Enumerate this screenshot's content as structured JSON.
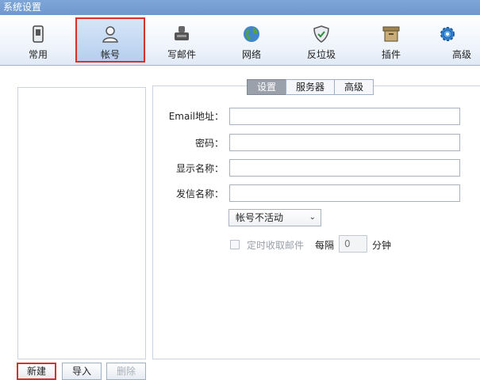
{
  "window": {
    "title": "系统设置"
  },
  "toolbar": {
    "items": [
      {
        "label": "常用",
        "icon": "phone-icon"
      },
      {
        "label": "帐号",
        "icon": "user-icon"
      },
      {
        "label": "写邮件",
        "icon": "compose-icon"
      },
      {
        "label": "网络",
        "icon": "globe-icon"
      },
      {
        "label": "反垃圾",
        "icon": "shield-icon"
      },
      {
        "label": "插件",
        "icon": "box-icon"
      },
      {
        "label": "高级",
        "icon": "gear-icon"
      }
    ],
    "active": "帐号"
  },
  "tabs": [
    {
      "label": "设置"
    },
    {
      "label": "服务器"
    },
    {
      "label": "高级"
    }
  ],
  "form": {
    "email_label": "Email地址：",
    "email_value": "",
    "password_label": "密码：",
    "password_value": "",
    "display_name_label": "显示名称：",
    "display_name_value": "",
    "sender_name_label": "发信名称：",
    "sender_name_value": "",
    "status_select": "帐号不活动",
    "timed_fetch_label": "定时收取邮件",
    "every_label": "每隔",
    "interval_value": "0",
    "unit_label": "分钟"
  },
  "buttons": {
    "new": "新建",
    "import": "导入",
    "delete": "删除"
  },
  "colors": {
    "highlight": "#d9302a",
    "titlebar": "#7ea6d8"
  }
}
